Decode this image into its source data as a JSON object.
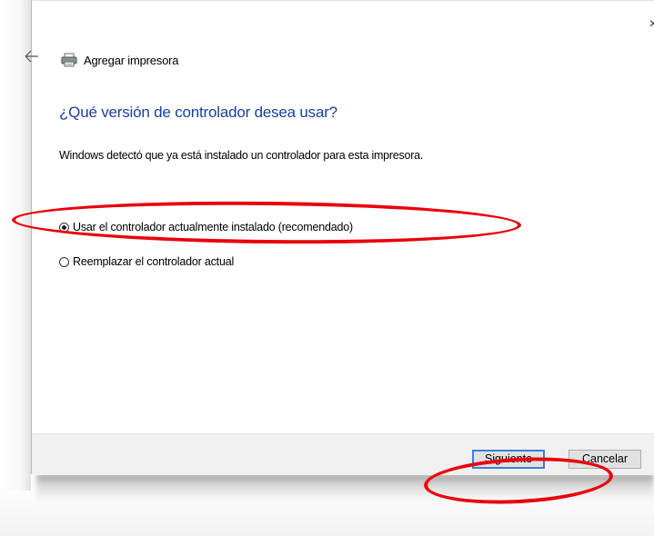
{
  "window": {
    "title": "Agregar impresora",
    "close_glyph": "×"
  },
  "page": {
    "heading": "¿Qué versión de controlador desea usar?",
    "description": "Windows detectó que ya está instalado un controlador para esta impresora."
  },
  "options": [
    {
      "label": "Usar el controlador actualmente instalado (recomendado)",
      "selected": true
    },
    {
      "label": "Reemplazar el controlador actual",
      "selected": false
    }
  ],
  "footer": {
    "next_label": "Siguiente",
    "cancel_label": "Cancelar"
  },
  "colors": {
    "heading": "#1a3f9e",
    "annotation": "#e8000b",
    "default_button_border": "#3c7fd6"
  },
  "icons": {
    "back": "back-arrow-icon",
    "printer": "printer-icon",
    "close": "close-icon"
  }
}
